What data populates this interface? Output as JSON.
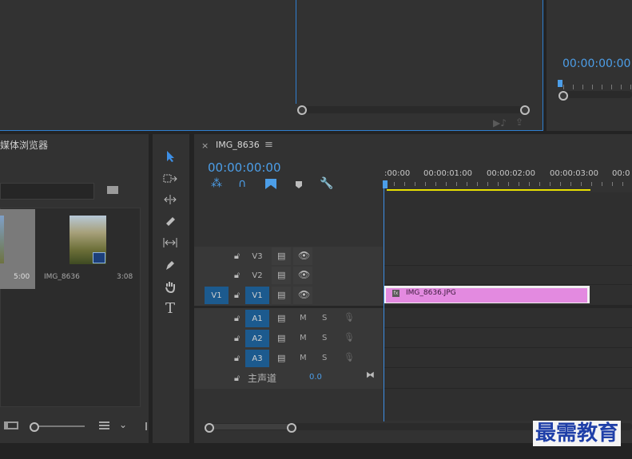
{
  "source_monitor": {},
  "program_monitor": {
    "timecode": "00:00:00:00"
  },
  "media_browser": {
    "title": "媒体浏览器",
    "items": [
      {
        "duration": "5:00"
      },
      {
        "name": "IMG_8636",
        "duration": "3:08"
      }
    ]
  },
  "timeline": {
    "close_glyph": "×",
    "sequence_name": "IMG_8636",
    "menu_glyph": "≡",
    "timecode": "00:00:00:00",
    "ruler": [
      ":00:00",
      "00:00:01:00",
      "00:00:02:00",
      "00:00:03:00",
      "00:0"
    ],
    "video_tracks": [
      {
        "name": "V3"
      },
      {
        "name": "V2"
      },
      {
        "name": "V1",
        "source": "V1"
      }
    ],
    "audio_tracks": [
      {
        "name": "A1",
        "m": "M",
        "s": "S"
      },
      {
        "name": "A2",
        "m": "M",
        "s": "S"
      },
      {
        "name": "A3",
        "m": "M",
        "s": "S"
      }
    ],
    "master": {
      "label": "主声道",
      "value": "0.0"
    },
    "clip": {
      "name": "IMG_8636.JPG",
      "fx": "fx",
      "color": "#e38ae0"
    }
  },
  "tools": [
    "selection-tool",
    "track-select-tool",
    "ripple-edit-tool",
    "razor-tool",
    "slip-tool",
    "pen-tool",
    "hand-tool",
    "type-tool"
  ],
  "tools_glyph": {
    "type": "T"
  },
  "watermark": "最需教育",
  "colors": {
    "accent": "#4c9ee8",
    "work_area": "#e8e000",
    "clip": "#e38ae0",
    "target": "#1c5a8e"
  }
}
